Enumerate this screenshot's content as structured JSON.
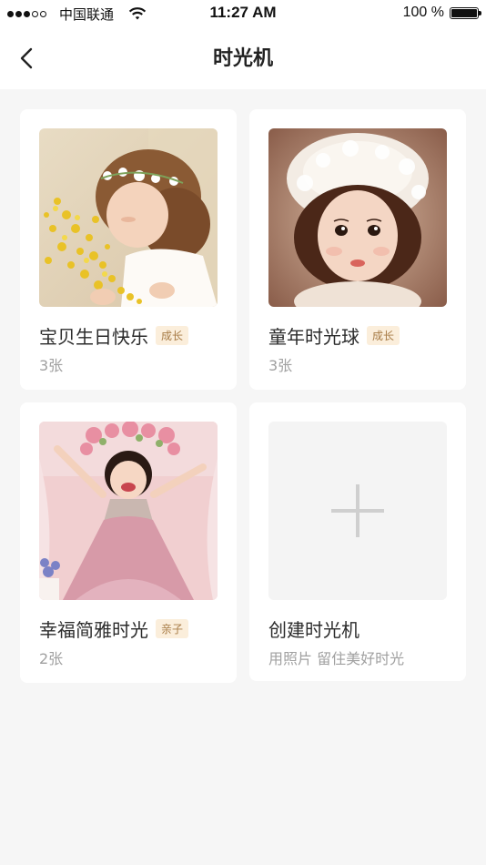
{
  "status_bar": {
    "carrier": "中国联通",
    "time": "11:27 AM",
    "battery_percent": "100 %",
    "signal_bars": 3,
    "signal_total": 5
  },
  "nav": {
    "title": "时光机",
    "back_icon": "chevron-left-icon"
  },
  "albums": [
    {
      "title": "宝贝生日快乐",
      "tag": "成长",
      "count": "3张",
      "photo": "girl-with-yellow-flowers"
    },
    {
      "title": "童年时光球",
      "tag": "成长",
      "count": "3张",
      "photo": "girl-in-lace-bonnet"
    },
    {
      "title": "幸福简雅时光",
      "tag": "亲子",
      "count": "2张",
      "photo": "girl-in-pink-dress"
    }
  ],
  "create_card": {
    "title": "创建时光机",
    "subtitle": "用照片 留住美好时光",
    "icon": "plus-icon"
  },
  "colors": {
    "background": "#f6f6f6",
    "card": "#ffffff",
    "tag_bg": "#fbeedb",
    "tag_text": "#a77b45",
    "muted_text": "#a0a0a0"
  }
}
